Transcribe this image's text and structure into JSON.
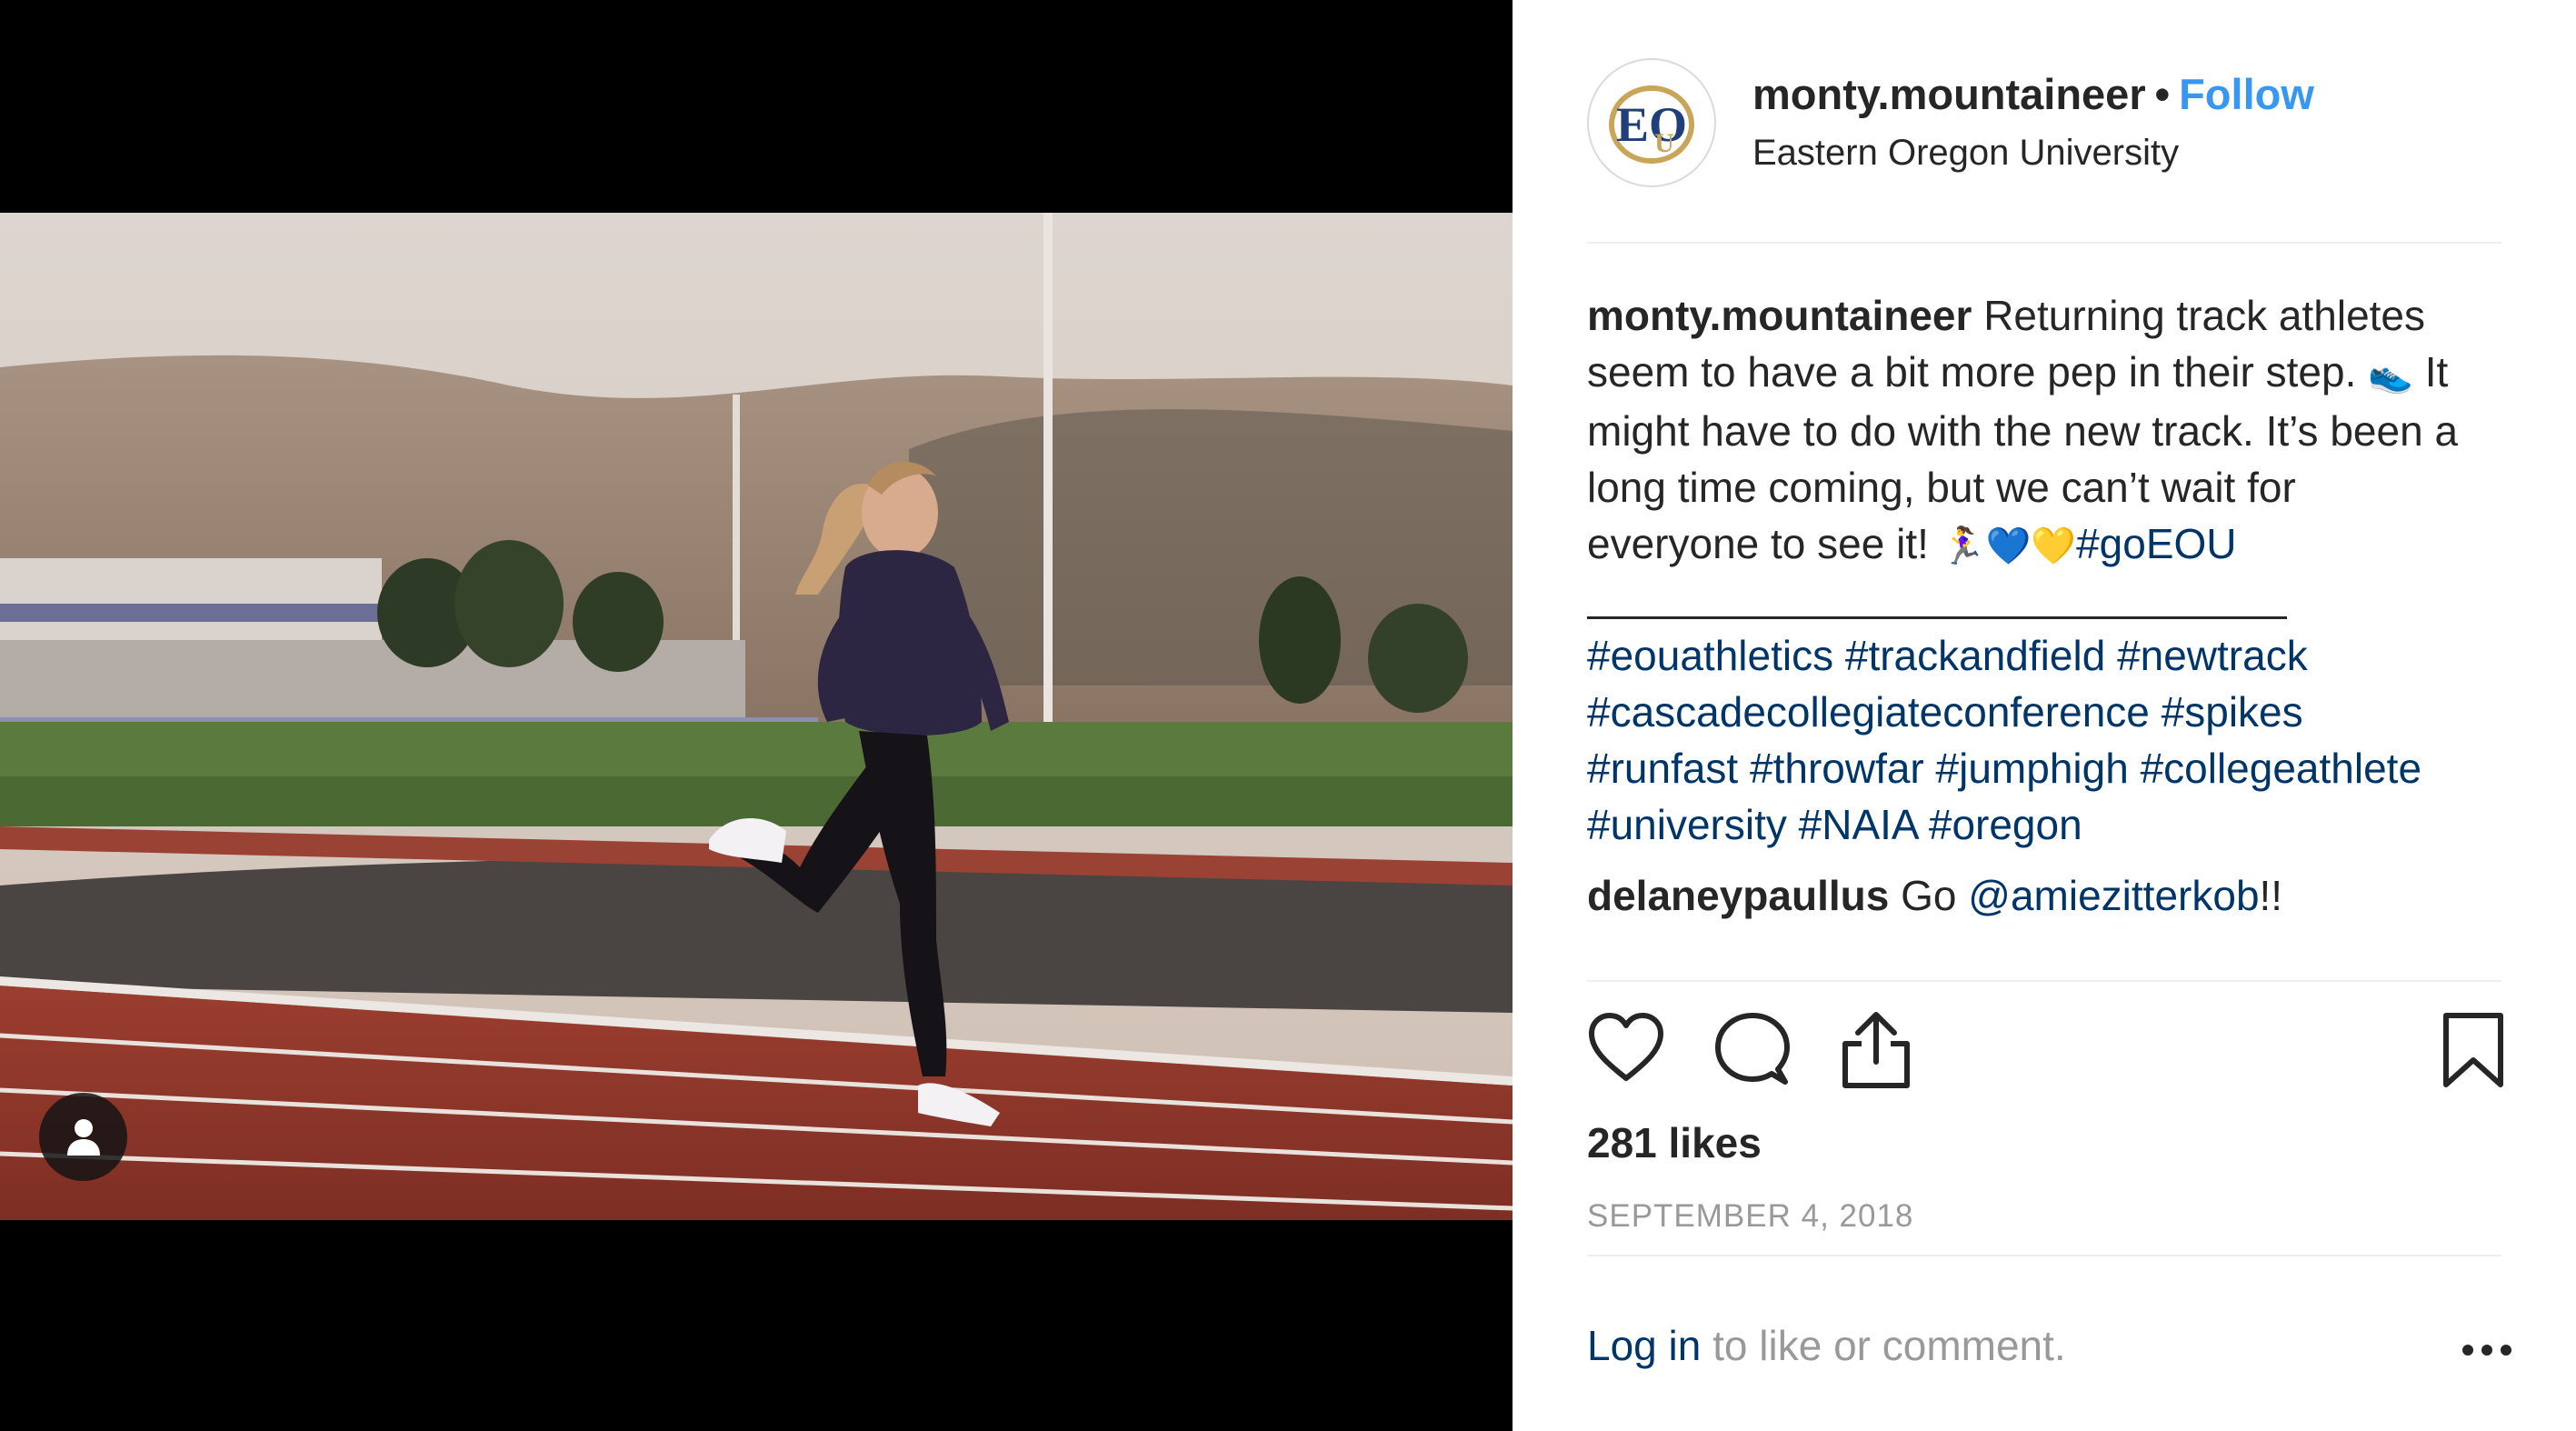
{
  "post": {
    "username": "monty.mountaineer",
    "separator": "•",
    "follow_label": "Follow",
    "location": "Eastern Oregon University",
    "avatar_logo_text": "EOU"
  },
  "caption": {
    "author": "monty.mountaineer",
    "line1_text": " Returning track athletes",
    "line2_text": "seem to have a bit more pep in their step. ",
    "line2_emoji": "👟",
    "line2_after": " It",
    "line3_text": "might have to do with the new track. It’s been a",
    "line4_text": "long time coming, but we can’t wait for",
    "line5_text": "everyone to see it! ",
    "line5_emoji": "🏃‍♀️💙💛",
    "line5_hashtag": "#goEOU"
  },
  "hashtags": {
    "line1": [
      "#eouathletics",
      "#trackandfield",
      "#newtrack"
    ],
    "line2": [
      "#cascadecollegiateconference",
      "#spikes"
    ],
    "line3": [
      "#runfast",
      "#throwfar",
      "#jumphigh",
      "#collegeathlete"
    ],
    "line4": [
      "#university",
      "#NAIA",
      "#oregon"
    ]
  },
  "comment": {
    "author": "delaneypaullus",
    "text_before": " Go ",
    "mention": "@amiezitterkob",
    "text_after": "!!"
  },
  "actions": {
    "like_icon": "heart-icon",
    "comment_icon": "comment-bubble-icon",
    "share_icon": "share-icon",
    "save_icon": "bookmark-icon"
  },
  "likes_label": "281 likes",
  "date": "SEPTEMBER 4, 2018",
  "footer": {
    "login_label": "Log in",
    "prompt": " to like or comment.",
    "more_icon": "more-options-icon"
  },
  "media": {
    "tag_icon": "user-tag-icon"
  },
  "colors": {
    "link_blue": "#3897f0",
    "hashtag_navy": "#003569",
    "muted_gray": "#999999",
    "text": "#262626"
  }
}
